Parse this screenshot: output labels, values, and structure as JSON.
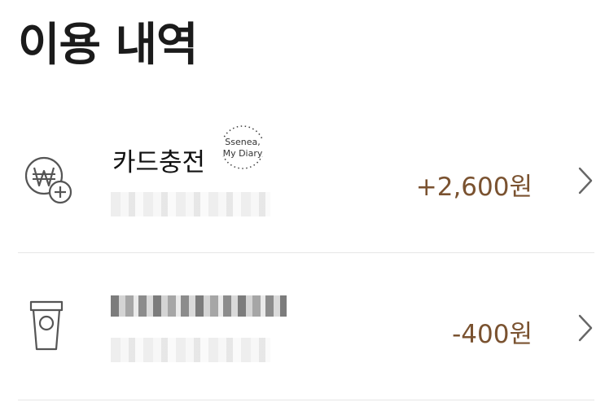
{
  "page": {
    "title": "이용 내역"
  },
  "transactions": [
    {
      "title": "카드충전",
      "amount": "+2,600원",
      "icon": "won-plus-icon",
      "stamp": [
        "Ssenea,",
        "My Diary"
      ]
    },
    {
      "title": "",
      "amount": "-400원",
      "icon": "coffee-cup-icon"
    }
  ],
  "colors": {
    "amount": "#7a5230",
    "divider": "#e6e6e6",
    "icon": "#555555"
  }
}
